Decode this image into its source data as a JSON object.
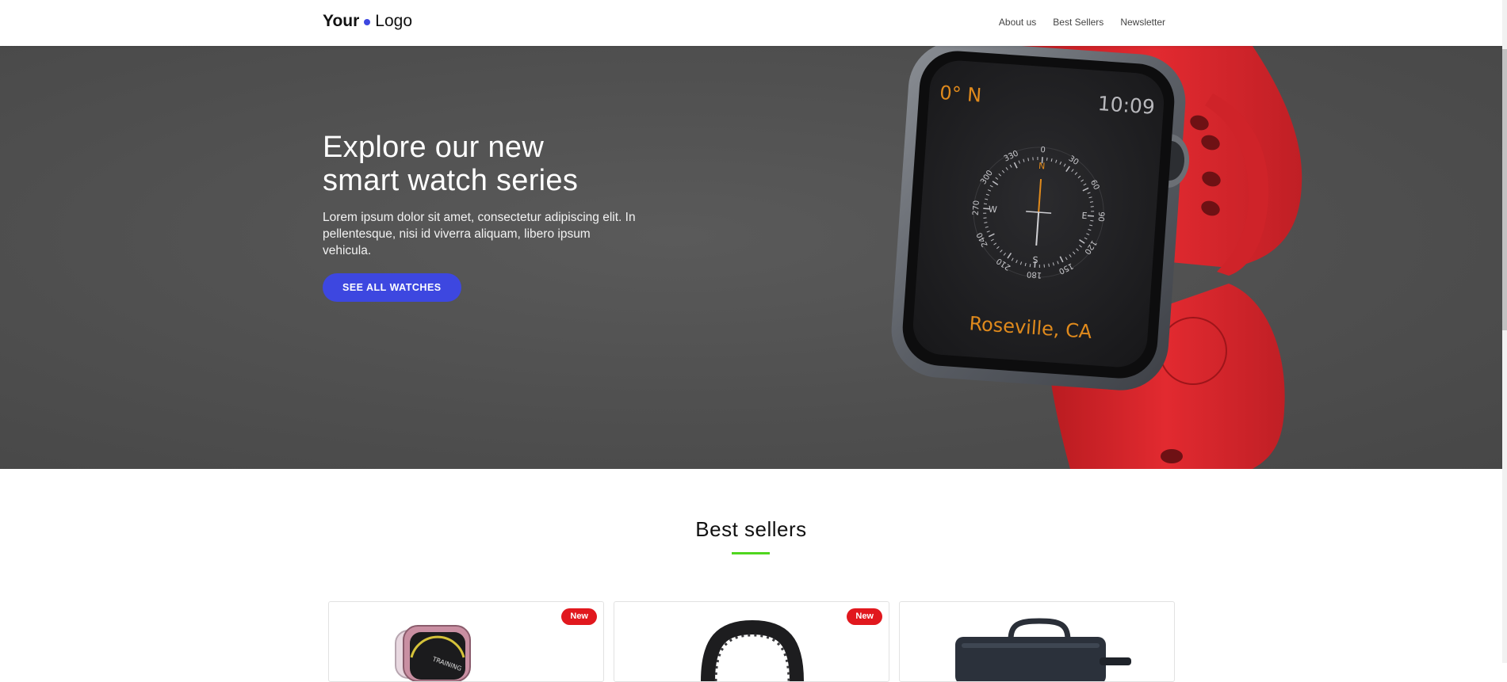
{
  "header": {
    "logo_your": "Your",
    "logo_logo": "Logo",
    "nav": [
      "About us",
      "Best Sellers",
      "Newsletter"
    ]
  },
  "hero": {
    "title": "Explore our new smart watch series",
    "description": "Lorem ipsum dolor sit amet, consectetur adipiscing elit. In pellentesque, nisi id viverra aliquam, libero ipsum vehicula.",
    "cta_label": "SEE ALL WATCHES",
    "watch_face": {
      "heading": "0° N",
      "time": "10:09",
      "location": "Roseville, CA",
      "compass_labels": [
        "0",
        "30",
        "60",
        "90",
        "120",
        "150",
        "180",
        "210",
        "240",
        "270",
        "300",
        "330"
      ],
      "cardinals": [
        "N",
        "E",
        "S",
        "W"
      ]
    }
  },
  "best_sellers": {
    "title": "Best sellers",
    "cards": [
      {
        "badge": "New",
        "product_icon": "watch-case-icon"
      },
      {
        "badge": "New",
        "product_icon": "watch-band-icon"
      },
      {
        "badge": "",
        "product_icon": "watch-bag-icon"
      }
    ]
  },
  "colors": {
    "accent_blue": "#3d47e0",
    "underline_green": "#4fd61f",
    "badge_red": "#e1181e",
    "hero_bg": "#525252",
    "strap_red": "#e0282e",
    "face_orange": "#e08a1c"
  }
}
